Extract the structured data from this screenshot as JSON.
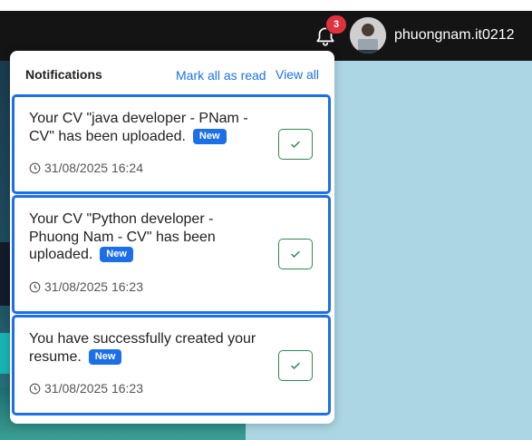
{
  "header": {
    "notification_count": "3",
    "username": "phuongnam.it0212"
  },
  "notifications_panel": {
    "title": "Notifications",
    "mark_all_label": "Mark all as read",
    "view_all_label": "View all",
    "items": [
      {
        "message": "Your CV \"java developer - PNam - CV\" has been uploaded.",
        "badge": "New",
        "time": "31/08/2025 16:24"
      },
      {
        "message": "Your CV \"Python developer - Phuong Nam - CV\" has been uploaded.",
        "badge": "New",
        "time": "31/08/2025 16:23"
      },
      {
        "message": "You have successfully created your resume.",
        "badge": "New",
        "time": "31/08/2025 16:23"
      }
    ]
  },
  "icons": {
    "bell": "bell-icon",
    "clock": "clock-icon",
    "check": "check-icon"
  },
  "colors": {
    "accent": "#1d6fe8",
    "topbar": "#141414",
    "badge_red": "#e0313f",
    "check_green": "#2d8a52"
  }
}
